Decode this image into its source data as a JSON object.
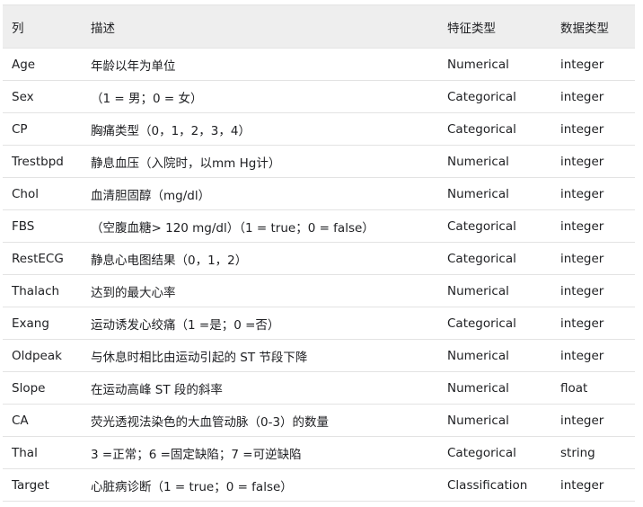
{
  "table": {
    "headers": [
      "列",
      "描述",
      "特征类型",
      "数据类型"
    ],
    "rows": [
      [
        "Age",
        "年龄以年为单位",
        "Numerical",
        "integer"
      ],
      [
        "Sex",
        "（1 = 男；0 = 女）",
        "Categorical",
        "integer"
      ],
      [
        "CP",
        "胸痛类型（0，1，2，3，4）",
        "Categorical",
        "integer"
      ],
      [
        "Trestbpd",
        "静息血压（入院时，以mm Hg计）",
        "Numerical",
        "integer"
      ],
      [
        "Chol",
        "血清胆固醇（mg/dl）",
        "Numerical",
        "integer"
      ],
      [
        "FBS",
        "（空腹血糖> 120 mg/dl）（1 = true；0 = false）",
        "Categorical",
        "integer"
      ],
      [
        "RestECG",
        "静息心电图结果（0，1，2）",
        "Categorical",
        "integer"
      ],
      [
        "Thalach",
        "达到的最大心率",
        "Numerical",
        "integer"
      ],
      [
        "Exang",
        "运动诱发心绞痛（1 =是；0 =否）",
        "Categorical",
        "integer"
      ],
      [
        "Oldpeak",
        "与休息时相比由运动引起的 ST 节段下降",
        "Numerical",
        "integer"
      ],
      [
        "Slope",
        "在运动高峰 ST 段的斜率",
        "Numerical",
        "float"
      ],
      [
        "CA",
        "荧光透视法染色的大血管动脉（0-3）的数量",
        "Numerical",
        "integer"
      ],
      [
        "Thal",
        "3 =正常；6 =固定缺陷；7 =可逆缺陷",
        "Categorical",
        "string"
      ],
      [
        "Target",
        "心脏病诊断（1 = true；0 = false）",
        "Classification",
        "integer"
      ]
    ]
  }
}
